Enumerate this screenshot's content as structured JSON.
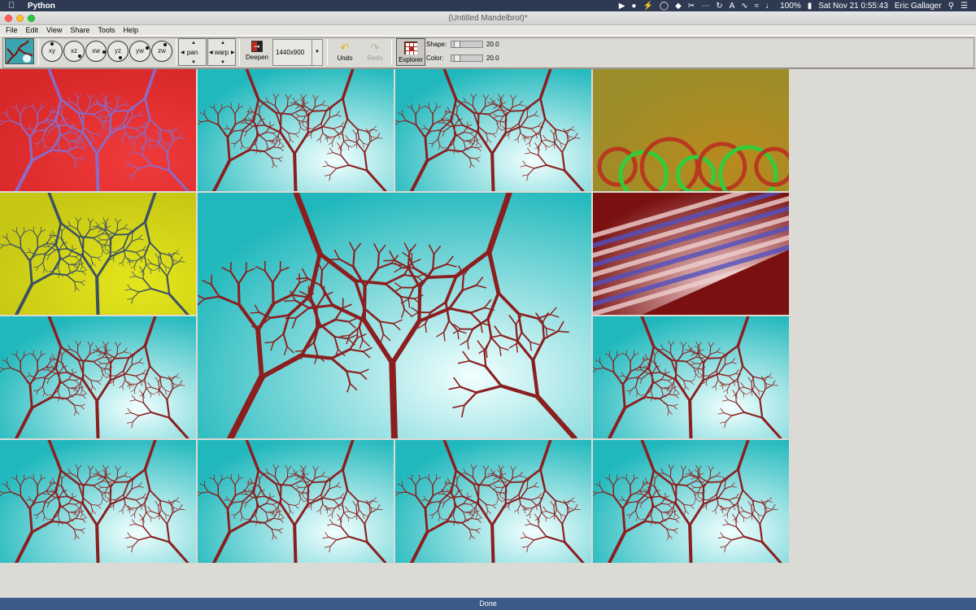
{
  "menubar": {
    "app_name": "Python",
    "battery": "100%",
    "clock": "Sat Nov 21  0:55:43",
    "user": "Eric Gallager"
  },
  "window": {
    "title": "(Untitled Mandelbrot)*"
  },
  "app_menu": [
    "File",
    "Edit",
    "View",
    "Share",
    "Tools",
    "Help"
  ],
  "toolbar": {
    "planes": [
      "xy",
      "xz",
      "xw",
      "yz",
      "yw",
      "zw"
    ],
    "pan_label": "pan",
    "warp_label": "warp",
    "deepen_label": "Deepen",
    "size_value": "1440x900",
    "undo_label": "Undo",
    "redo_label": "Redo",
    "explorer_label": "Explorer",
    "shape_label": "Shape:",
    "shape_value": "20.0",
    "color_label": "Color:",
    "color_value": "20.0"
  },
  "tiles": [
    {
      "name": "variant-red-violet",
      "palette": [
        "#d8282a",
        "#f03a3a",
        "#8a6cc8",
        "#2c1a2a"
      ]
    },
    {
      "name": "variant-teal-1",
      "palette": [
        "#20b8bc",
        "#f2ffff",
        "#8b1e1e",
        "#2a1212"
      ]
    },
    {
      "name": "variant-teal-2",
      "palette": [
        "#20b8bc",
        "#f2ffff",
        "#8b1e1e",
        "#2a1212"
      ]
    },
    {
      "name": "variant-olive-green",
      "palette": [
        "#9a8d2a",
        "#b88a1e",
        "#33cc3a",
        "#b83a1e"
      ]
    },
    {
      "name": "variant-yellow-slate",
      "palette": [
        "#c6c614",
        "#e3e61c",
        "#3c5064",
        "#1e2c3a"
      ]
    },
    {
      "name": "main-view-teal",
      "palette": [
        "#20b8bc",
        "#f2ffff",
        "#8b1e1e",
        "#2a1212"
      ]
    },
    {
      "name": "variant-dark-stripes",
      "palette": [
        "#7a1010",
        "#f0d0d0",
        "#5050c0",
        "#0a0a12"
      ]
    },
    {
      "name": "variant-teal-3",
      "palette": [
        "#20b8bc",
        "#f2ffff",
        "#8b1e1e",
        "#2a1212"
      ]
    },
    {
      "name": "variant-teal-4",
      "palette": [
        "#20b8bc",
        "#f2ffff",
        "#8b1e1e",
        "#2a1212"
      ]
    },
    {
      "name": "variant-teal-5",
      "palette": [
        "#20b8bc",
        "#f2ffff",
        "#8b1e1e",
        "#2a1212"
      ]
    },
    {
      "name": "variant-teal-6",
      "palette": [
        "#20b8bc",
        "#f2ffff",
        "#8b1e1e",
        "#2a1212"
      ]
    },
    {
      "name": "variant-teal-7",
      "palette": [
        "#20b8bc",
        "#f2ffff",
        "#8b1e1e",
        "#2a1212"
      ]
    },
    {
      "name": "variant-teal-8",
      "palette": [
        "#20b8bc",
        "#f2ffff",
        "#8b1e1e",
        "#2a1212"
      ]
    }
  ],
  "status": {
    "text": "Done"
  }
}
